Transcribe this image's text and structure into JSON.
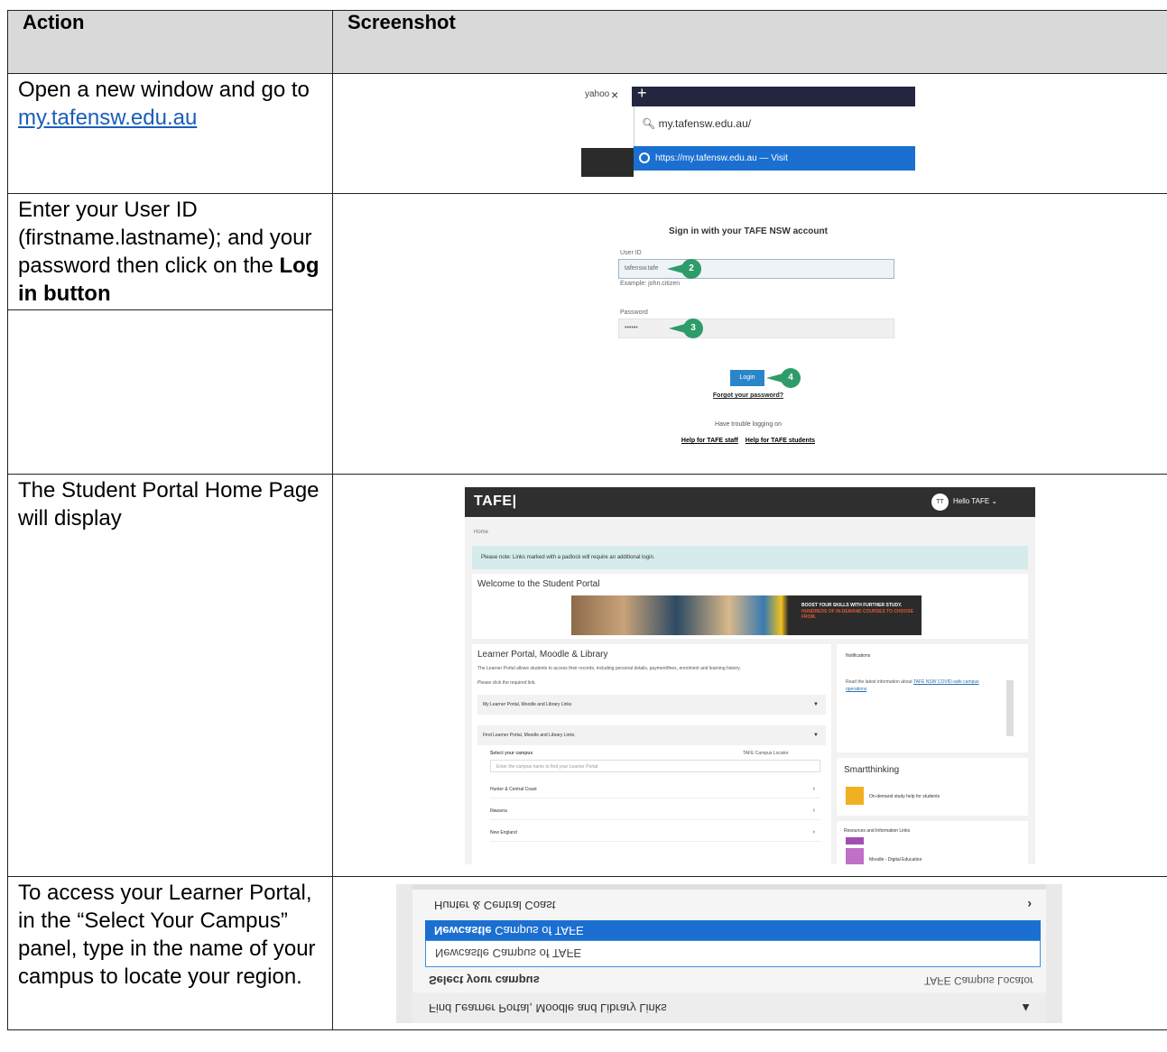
{
  "header": {
    "col_action": "Action",
    "col_screenshot": "Screenshot"
  },
  "steps": [
    {
      "action_prefix": "Open a new window and go to ",
      "action_link": "my.tafensw.edu.au"
    },
    {
      "action_prefix": "Enter your User ID (firstname.lastname); and your password then click on the ",
      "action_bold": "Log in button"
    },
    {
      "action": "The Student Portal Home Page will display"
    },
    {
      "action": "To access your Learner Portal, in the “Select Your Campus” panel, type in the name of your campus to locate your region."
    }
  ],
  "shot1": {
    "tab_text": "yahoo",
    "close_glyph": "×",
    "plus_glyph": "+",
    "address_text": "my.tafensw.edu.au/",
    "suggestion_text": "https://my.tafensw.edu.au — Visit"
  },
  "shot2": {
    "title": "Sign in with your TAFE NSW account",
    "user_label": "User ID",
    "user_value": "tafensw.tafe",
    "user_hint": "Example: john.citizen",
    "pw_label": "Password",
    "pw_value": "••••••",
    "badge_user": "2",
    "badge_pw": "3",
    "badge_login": "4",
    "login_label": "Login",
    "forgot": "Forgot your password?",
    "trouble": "Have trouble logging on",
    "help_staff": "Help for TAFE staff",
    "help_students": "Help for TAFE students"
  },
  "shot3": {
    "logo": "TAFE|",
    "avatar": "TT",
    "hello": "Hello TAFE ⌄",
    "crumb": "Home",
    "alert": "Please note: Links marked with a padlock will require an additional login.",
    "welcome": "Welcome to the Student Portal",
    "banner_line1": "BOOST YOUR SKILLS WITH FURTHER STUDY.",
    "banner_line2": "HUNDREDS OF IN-DEMAND COURSES TO CHOOSE FROM.",
    "lp_title": "Learner Portal, Moodle & Library",
    "lp_text": "The Learner Portal allows students to access their records, including personal details, payment/fees, enrolment and learning history.",
    "lp_check": "Please click the required link.",
    "row1": "My Learner Portal, Moodle and Library Links",
    "row2": "Find Learner Portal, Moodle and Library Links",
    "select_campus": "Select your campus",
    "tafe_campus": "TAFE Campus Locator",
    "input_ph": "Enter the campus name to find your Learner Portal",
    "region1": "Hunter & Central Coast",
    "region2": "Illawarra",
    "region3": "New England",
    "notif_h": "Notifications",
    "notif_b": "Read the latest information about",
    "notif_link": "TAFE NSW COVID-safe campus operations",
    "smart_h": "Smartthinking",
    "smart_t": "On-demand study help for students",
    "res_h": "Resources and Information Links",
    "res_t": "Moodle - Digital Education"
  },
  "shot4": {
    "find_row": "Find Learner Portal, Moodle and Library Links",
    "select": "Select your campus",
    "locator": "TAFE Campus Locator",
    "typed": "Newcastle Campus of TAFE",
    "highlight_bold": "Newcastle",
    "highlight_rest": " Campus of TAFE",
    "region": "Hunter & Central Coast"
  }
}
